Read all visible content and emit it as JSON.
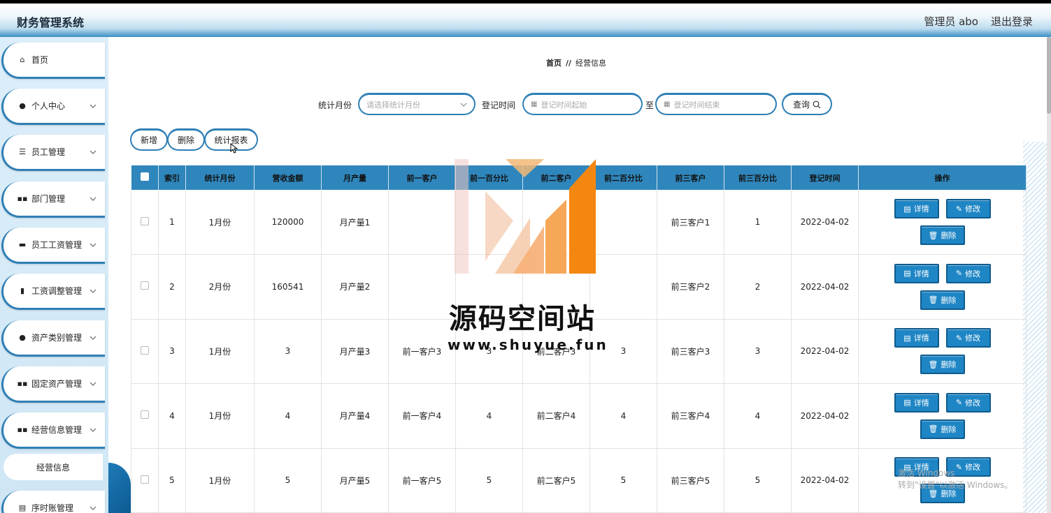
{
  "header": {
    "app_title": "财务管理系统",
    "admin_label": "管理员 abo",
    "logout_label": "退出登录"
  },
  "sidebar": {
    "items": [
      {
        "label": "首页",
        "icon": "home-icon",
        "has_chevron": false
      },
      {
        "label": "个人中心",
        "icon": "user-icon",
        "has_chevron": true
      },
      {
        "label": "员工管理",
        "icon": "menu-icon",
        "has_chevron": true
      },
      {
        "label": "部门管理",
        "icon": "grid-icon",
        "has_chevron": true
      },
      {
        "label": "员工工资管理",
        "icon": "monitor-icon",
        "has_chevron": true
      },
      {
        "label": "工资调整管理",
        "icon": "chart-icon",
        "has_chevron": true
      },
      {
        "label": "资产类别管理",
        "icon": "user-icon",
        "has_chevron": true
      },
      {
        "label": "固定资产管理",
        "icon": "grid-icon",
        "has_chevron": true
      },
      {
        "label": "经营信息管理",
        "icon": "grid-icon",
        "has_chevron": true
      },
      {
        "label": "序时账管理",
        "icon": "document-icon",
        "has_chevron": true
      }
    ],
    "sub_item": "经营信息"
  },
  "breadcrumb": {
    "home": "首页",
    "separator": "//",
    "current": "经营信息"
  },
  "search": {
    "month_label": "统计月份",
    "month_placeholder": "请选择统计月份",
    "time_label": "登记时间",
    "time_start_placeholder": "登记时间起始",
    "to_label": "至",
    "time_end_placeholder": "登记时间结束",
    "query_label": "查询"
  },
  "actions": {
    "add": "新增",
    "delete": "删除",
    "report": "统计报表"
  },
  "table": {
    "columns": [
      "索引",
      "统计月份",
      "营收金额",
      "月产量",
      "前一客户",
      "前一百分比",
      "前二客户",
      "前二百分比",
      "前三客户",
      "前三百分比",
      "登记时间",
      "操作"
    ],
    "rows": [
      {
        "index": "1",
        "month": "1月份",
        "revenue": "120000",
        "output": "月产量1",
        "c1": "",
        "p1": "",
        "c2": "",
        "p2": "",
        "c3": "前三客户1",
        "p3": "1",
        "date": "2022-04-02"
      },
      {
        "index": "2",
        "month": "2月份",
        "revenue": "160541",
        "output": "月产量2",
        "c1": "",
        "p1": "",
        "c2": "",
        "p2": "",
        "c3": "前三客户2",
        "p3": "2",
        "date": "2022-04-02"
      },
      {
        "index": "3",
        "month": "1月份",
        "revenue": "3",
        "output": "月产量3",
        "c1": "前一客户3",
        "p1": "3",
        "c2": "前二客户3",
        "p2": "3",
        "c3": "前三客户3",
        "p3": "3",
        "date": "2022-04-02"
      },
      {
        "index": "4",
        "month": "1月份",
        "revenue": "4",
        "output": "月产量4",
        "c1": "前一客户4",
        "p1": "4",
        "c2": "前二客户4",
        "p2": "4",
        "c3": "前三客户4",
        "p3": "4",
        "date": "2022-04-02"
      },
      {
        "index": "5",
        "month": "1月份",
        "revenue": "5",
        "output": "月产量5",
        "c1": "前一客户5",
        "p1": "5",
        "c2": "前二客户5",
        "p2": "5",
        "c3": "前三客户5",
        "p3": "5",
        "date": "2022-04-02"
      }
    ],
    "op_labels": {
      "detail": "详情",
      "edit": "修改",
      "delete": "删除"
    }
  },
  "watermark": {
    "title": "源码空间站",
    "url": "www.shuyue.fun",
    "windows_line1": "激活 Windows",
    "windows_line2": "转到\"设置\"以激活 Windows。"
  },
  "colors": {
    "accent": "#2f86bc",
    "button": "#1f86c5",
    "sidebar_bg": "#dceefa"
  }
}
